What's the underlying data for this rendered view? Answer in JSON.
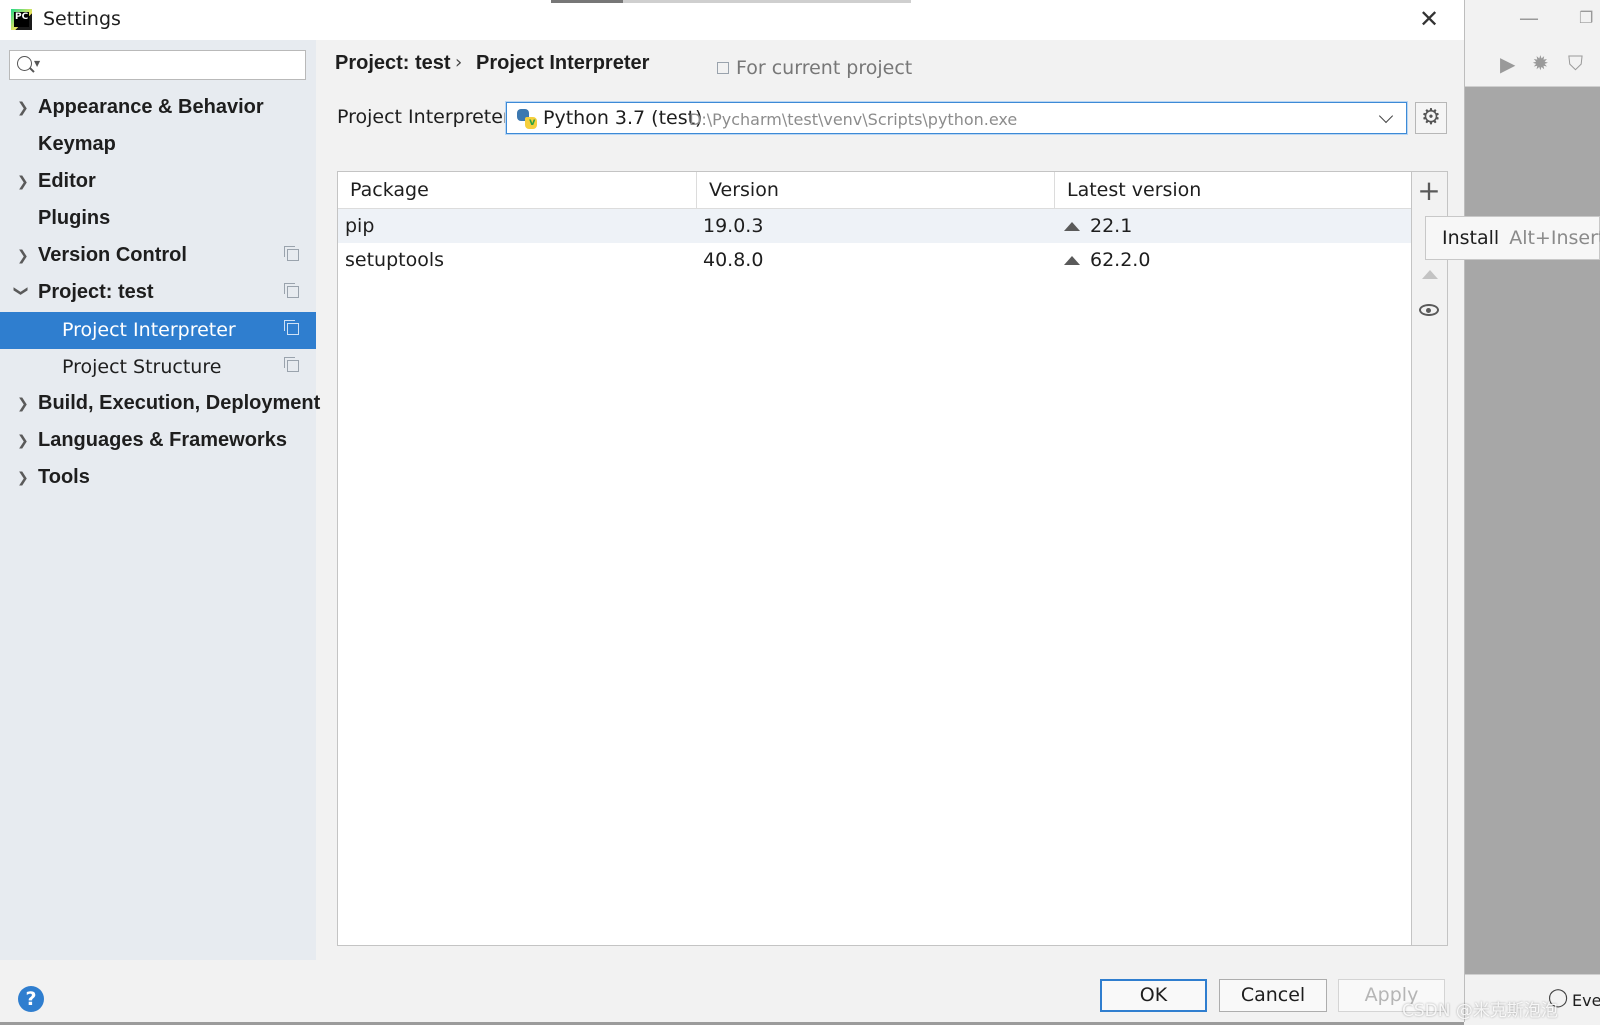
{
  "window": {
    "title": "Settings"
  },
  "search": {
    "placeholder": ""
  },
  "sidebar": {
    "items": [
      {
        "label": "Appearance & Behavior"
      },
      {
        "label": "Keymap"
      },
      {
        "label": "Editor"
      },
      {
        "label": "Plugins"
      },
      {
        "label": "Version Control"
      },
      {
        "label": "Project: test"
      },
      {
        "label": "Project Interpreter"
      },
      {
        "label": "Project Structure"
      },
      {
        "label": "Build, Execution, Deployment"
      },
      {
        "label": "Languages & Frameworks"
      },
      {
        "label": "Tools"
      }
    ]
  },
  "breadcrumb": {
    "parent": "Project: test",
    "separator": "›",
    "current": "Project Interpreter",
    "scope": "For current project"
  },
  "interpreter": {
    "label": "Project Interpreter:",
    "name": "Python 3.7 (test)",
    "path": "D:\\Pycharm\\test\\venv\\Scripts\\python.exe"
  },
  "table": {
    "columns": [
      "Package",
      "Version",
      "Latest version"
    ],
    "rows": [
      {
        "package": "pip",
        "version": "19.0.3",
        "latest": "22.1"
      },
      {
        "package": "setuptools",
        "version": "40.8.0",
        "latest": "62.2.0"
      }
    ]
  },
  "tools": {
    "add": "+"
  },
  "tooltip": {
    "action": "Install",
    "shortcut": "Alt+Insert"
  },
  "footer": {
    "help": "?",
    "ok": "OK",
    "cancel": "Cancel",
    "apply": "Apply"
  },
  "background_ide": {
    "status_text": "Ever"
  },
  "watermark": "CSDN @米克斯泡泡",
  "colors": {
    "accent": "#2f7ecf",
    "selection_bg": "#2f7ecf",
    "sidebar_bg": "#e7ebf0"
  }
}
